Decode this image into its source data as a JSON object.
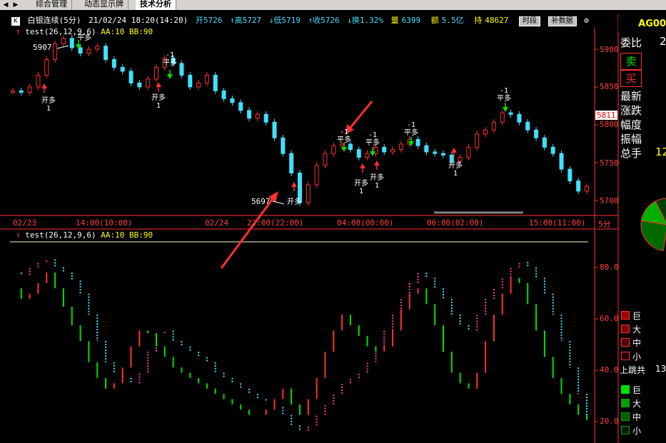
{
  "tabs": {
    "left_nav": "◀",
    "right_nav": "▶",
    "items": [
      {
        "label": "综合管理"
      },
      {
        "label": "动态显示牌"
      },
      {
        "label": "技术分析"
      }
    ]
  },
  "header": {
    "k_label": "K",
    "instrument": "白银连续(5分)",
    "datetime": "21/02/24 18:20(14:20)",
    "open": "开5726",
    "high": "↑高5727",
    "low": "↓低5719",
    "close": "↑收5726",
    "turnover_rate": "↓换1.32%",
    "volume_label": "量",
    "volume": "6399",
    "amount_label": "额",
    "amount": "5.5亿",
    "position_label": "持",
    "position": "48627",
    "btn_period": "时段",
    "btn_supplement": "补数据"
  },
  "indicator": {
    "name": "test(26,12,9,6)",
    "params": "AA:10 BB:90"
  },
  "price_axis": [
    "5900",
    "5850",
    "5800",
    "5750",
    "5700"
  ],
  "price_ylim": [
    5690,
    5915
  ],
  "current_price_tag": "5811",
  "price_annotations": {
    "high_label": "5907",
    "low_label": "5697"
  },
  "signals": {
    "open_long": "开多",
    "close_long": "平多",
    "one": "1",
    "minus_one": "-1"
  },
  "time_axis": {
    "labels": [
      "02/23",
      "14:00(10:00)",
      "02/24",
      "22:00(22:00)",
      "04:00(00:00)",
      "06:00(02:00)",
      "15:00(11:00)"
    ],
    "period": "5分"
  },
  "osc_axis": [
    "80.0",
    "60.0",
    "40.0",
    "20.0"
  ],
  "osc_ylim": [
    15,
    88
  ],
  "right_panel": {
    "code": "AG00",
    "weibi": "委比",
    "weibi_val": "2",
    "sell": "卖",
    "buy": "买",
    "latest": "最新",
    "change": "涨跌",
    "range": "幅度",
    "amplitude": "振幅",
    "total": "总手",
    "total_val": "12",
    "legend_up": [
      "巨",
      "大",
      "中",
      "小"
    ],
    "jump_label": "上跳共",
    "jump_val": "13",
    "legend_down": [
      "巨",
      "大",
      "中",
      "小"
    ]
  },
  "colors": {
    "up": "#ff3030",
    "down": "#40e0ff",
    "green": "#00e000",
    "axis": "#ff3030",
    "pink": "#ff3ca0"
  },
  "chart_data": {
    "type": "line",
    "series": [
      {
        "values": [
          5840,
          5838,
          5845,
          5860,
          5880,
          5900,
          5907,
          5895,
          5888,
          5893,
          5897,
          5880,
          5870,
          5865,
          5850,
          5845,
          5855,
          5870,
          5882,
          5875,
          5860,
          5845,
          5850,
          5860,
          5840,
          5830,
          5825,
          5815,
          5805,
          5810,
          5800,
          5780,
          5760,
          5735,
          5697,
          5720,
          5745,
          5760,
          5770,
          5772,
          5765,
          5755,
          5760,
          5768,
          5762,
          5765,
          5772,
          5778,
          5770,
          5762,
          5760,
          5758,
          5750,
          5755,
          5768,
          5785,
          5790,
          5800,
          5812,
          5810,
          5800,
          5790,
          5780,
          5768,
          5760,
          5740,
          5725,
          5712,
          5718
        ]
      },
      {
        "values": [
          78,
          77,
          80,
          82,
          83,
          80,
          78,
          75,
          70,
          62,
          52,
          44,
          40,
          38,
          36,
          40,
          48,
          55,
          56,
          52,
          50,
          48,
          46,
          44,
          40,
          38,
          36,
          34,
          32,
          30,
          29,
          27,
          24,
          20,
          18,
          20,
          24,
          28,
          32,
          36,
          38,
          40,
          44,
          50,
          56,
          62,
          68,
          74,
          78,
          76,
          72,
          68,
          62,
          58,
          56,
          62,
          68,
          72,
          76,
          80,
          82,
          80,
          76,
          70,
          62,
          52,
          42,
          32,
          22
        ]
      },
      {
        "values": [
          72,
          68,
          70,
          74,
          78,
          72,
          65,
          58,
          52,
          44,
          38,
          34,
          36,
          42,
          50,
          56,
          55,
          50,
          46,
          42,
          40,
          38,
          36,
          34,
          32,
          30,
          28,
          26,
          24,
          24,
          26,
          30,
          34,
          28,
          24,
          30,
          38,
          48,
          56,
          62,
          58,
          54,
          50,
          48,
          50,
          56,
          64,
          70,
          72,
          66,
          58,
          48,
          40,
          36,
          34,
          40,
          52,
          62,
          70,
          76,
          74,
          66,
          56,
          46,
          38,
          32,
          28,
          24,
          22
        ]
      }
    ]
  }
}
